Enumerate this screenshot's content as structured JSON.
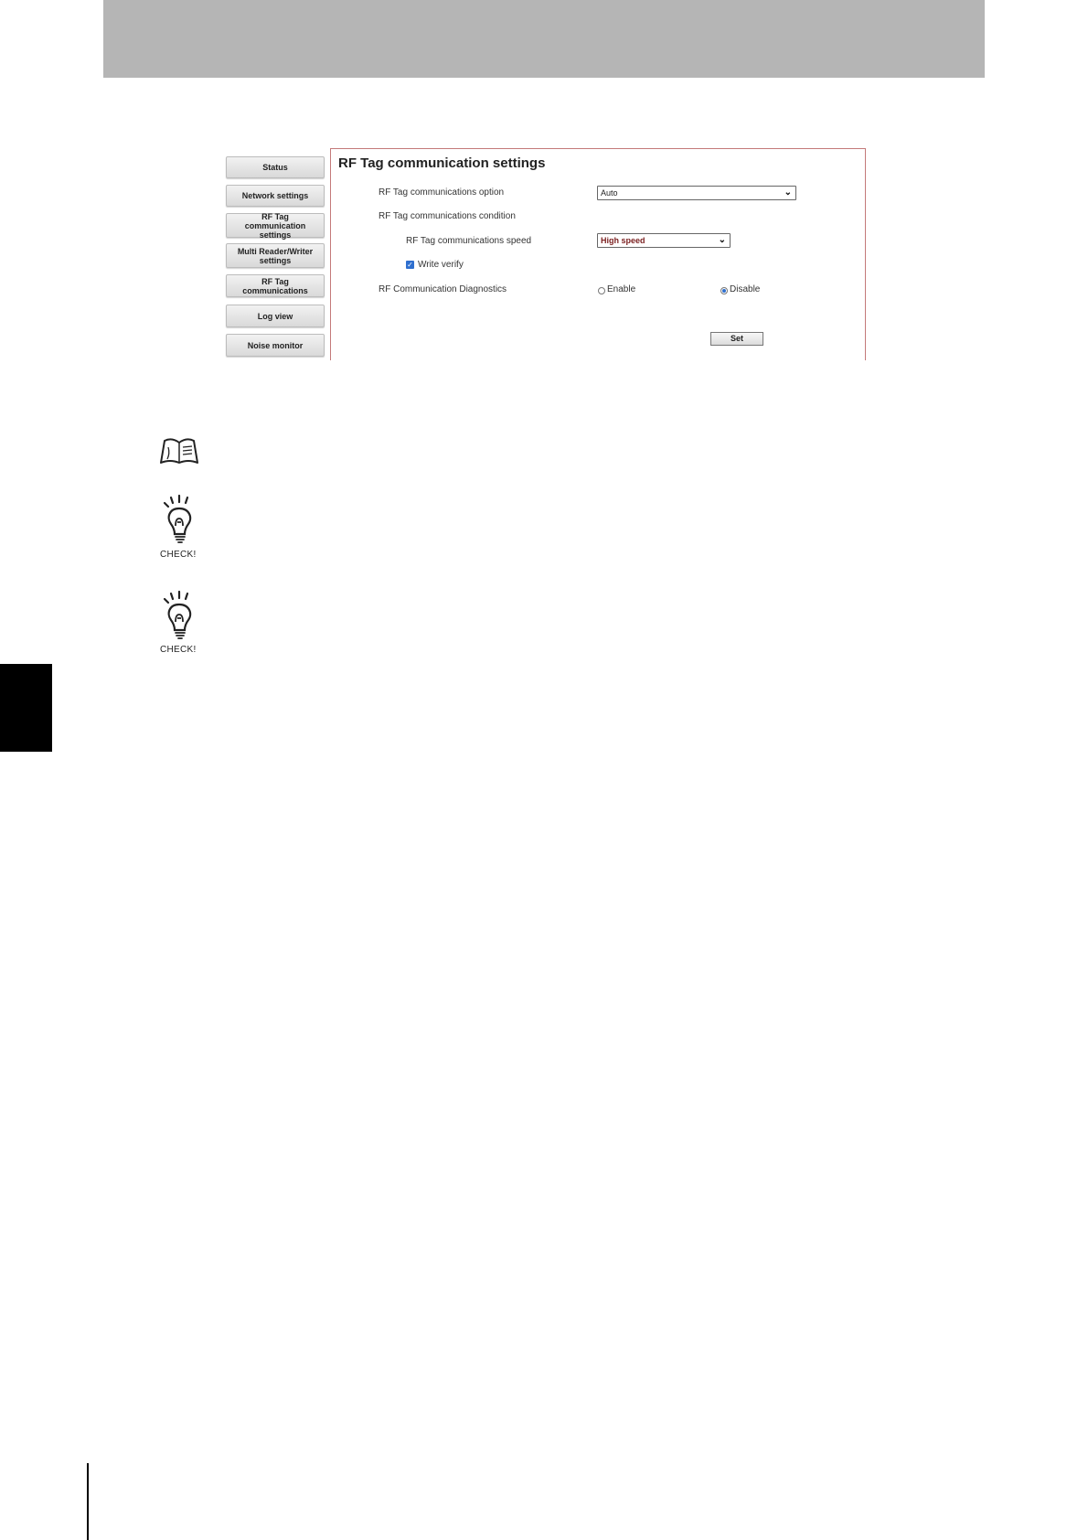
{
  "nav": {
    "items": [
      {
        "label": "Status"
      },
      {
        "label": "Network settings"
      },
      {
        "label": "RF Tag communication settings"
      },
      {
        "label": "Multi Reader/Writer settings"
      },
      {
        "label": "RF Tag communications"
      },
      {
        "label": "Log view"
      },
      {
        "label": "Noise monitor"
      }
    ]
  },
  "panel": {
    "title": "RF Tag communication settings",
    "option_label": "RF Tag communications option",
    "option_value": "Auto",
    "condition_label": "RF Tag communications condition",
    "speed_label": "RF Tag communications speed",
    "speed_value": "High speed",
    "write_verify_label": "Write verify",
    "write_verify_checked": true,
    "diagnostics_label": "RF Communication Diagnostics",
    "enable_label": "Enable",
    "disable_label": "Disable",
    "diagnostics_selected": "Disable",
    "set_label": "Set"
  },
  "notes": {
    "check_label_1": "CHECK!",
    "check_label_2": "CHECK!"
  },
  "colors": {
    "header_bar": "#b5b5b5",
    "panel_border": "#c47a7a",
    "accent": "#2f6fcf",
    "side_tab": "#000000"
  }
}
